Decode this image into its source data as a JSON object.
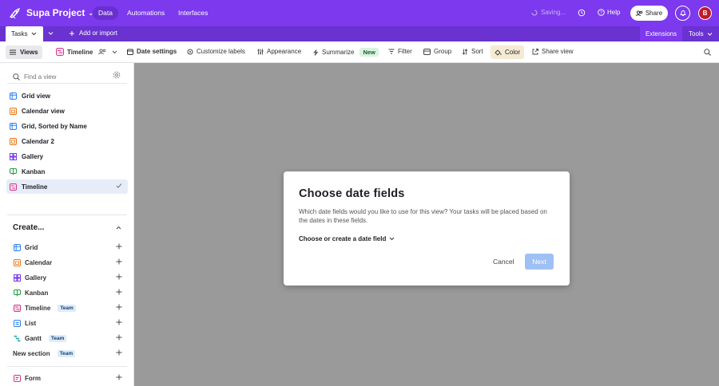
{
  "header": {
    "project_name": "Supa Project",
    "tabs": [
      {
        "label": "Data"
      },
      {
        "label": "Automations"
      },
      {
        "label": "Interfaces"
      }
    ],
    "saving_label": "Saving...",
    "help_label": "Help",
    "share_label": "Share",
    "avatar_initial": "B",
    "accent_color": "#7c39ed"
  },
  "table_bar": {
    "active_table": "Tasks",
    "add_import_label": "Add or import",
    "extensions_label": "Extensions",
    "tools_label": "Tools"
  },
  "toolbar": {
    "views_label": "Views",
    "current_view": "Timeline",
    "date_settings": "Date settings",
    "customize_labels": "Customize labels",
    "appearance": "Appearance",
    "summarize": "Summarize",
    "new_badge": "New",
    "filter": "Filter",
    "group": "Group",
    "sort": "Sort",
    "color": "Color",
    "share_view": "Share view"
  },
  "sidebar": {
    "find_placeholder": "Find a view",
    "views": [
      {
        "label": "Grid view",
        "icon": "grid-icon"
      },
      {
        "label": "Calendar view",
        "icon": "calendar-icon"
      },
      {
        "label": "Grid, Sorted by Name",
        "icon": "grid-icon"
      },
      {
        "label": "Calendar 2",
        "icon": "calendar-icon"
      },
      {
        "label": "Gallery",
        "icon": "gallery-icon"
      },
      {
        "label": "Kanban",
        "icon": "kanban-icon"
      },
      {
        "label": "Timeline",
        "icon": "timeline-icon",
        "selected": true
      }
    ],
    "create_label": "Create...",
    "create_items": [
      {
        "label": "Grid",
        "badge": ""
      },
      {
        "label": "Calendar",
        "badge": ""
      },
      {
        "label": "Gallery",
        "badge": ""
      },
      {
        "label": "Kanban",
        "badge": ""
      },
      {
        "label": "Timeline",
        "badge": "Team"
      },
      {
        "label": "List",
        "badge": ""
      },
      {
        "label": "Gantt",
        "badge": "Team"
      },
      {
        "label": "New section",
        "badge": "Team"
      }
    ],
    "form_label": "Form"
  },
  "modal": {
    "title": "Choose date fields",
    "description": "Which date fields would you like to use for this view? Your tasks will be placed based on the dates in these fields.",
    "choose_label": "Choose or create a date field",
    "cancel_label": "Cancel",
    "next_label": "Next"
  }
}
